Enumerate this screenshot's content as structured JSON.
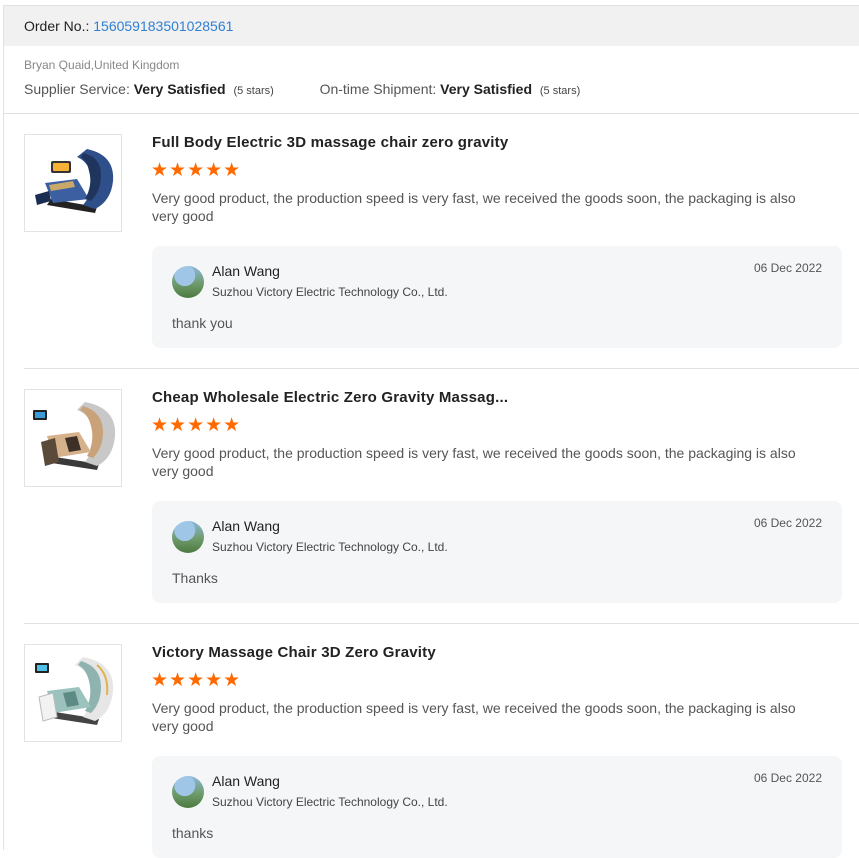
{
  "order": {
    "label": "Order No.:",
    "number": "156059183501028561"
  },
  "buyer": "Bryan Quaid,United Kingdom",
  "ratings": {
    "supplier_label": "Supplier Service:",
    "supplier_value": "Very Satisfied",
    "supplier_stars": "(5 stars)",
    "shipment_label": "On-time Shipment:",
    "shipment_value": "Very Satisfied",
    "shipment_stars": "(5 stars)"
  },
  "reviews": [
    {
      "product": "Full Body Electric 3D massage chair zero gravity",
      "stars": "★★★★★",
      "rating": 5,
      "text": "Very good product, the production speed is very fast, we received the goods soon, the packaging is also very good",
      "reply": {
        "name": "Alan Wang",
        "company": "Suzhou Victory Electric Technology Co., Ltd.",
        "date": "06 Dec 2022",
        "message": "thank you"
      }
    },
    {
      "product": "Cheap Wholesale Electric Zero Gravity Massag...",
      "stars": "★★★★★",
      "rating": 5,
      "text": "Very good product, the production speed is very fast, we received the goods soon, the packaging is also very good",
      "reply": {
        "name": "Alan Wang",
        "company": "Suzhou Victory Electric Technology Co., Ltd.",
        "date": "06 Dec 2022",
        "message": "Thanks"
      }
    },
    {
      "product": "Victory Massage Chair 3D Zero Gravity",
      "stars": "★★★★★",
      "rating": 5,
      "text": "Very good product, the production speed is very fast, we received the goods soon, the packaging is also very good",
      "reply": {
        "name": "Alan Wang",
        "company": "Suzhou Victory Electric Technology Co., Ltd.",
        "date": "06 Dec 2022",
        "message": "thanks"
      }
    }
  ],
  "colors": {
    "accent_link": "#2f7fd2",
    "star": "#ff6a00"
  }
}
